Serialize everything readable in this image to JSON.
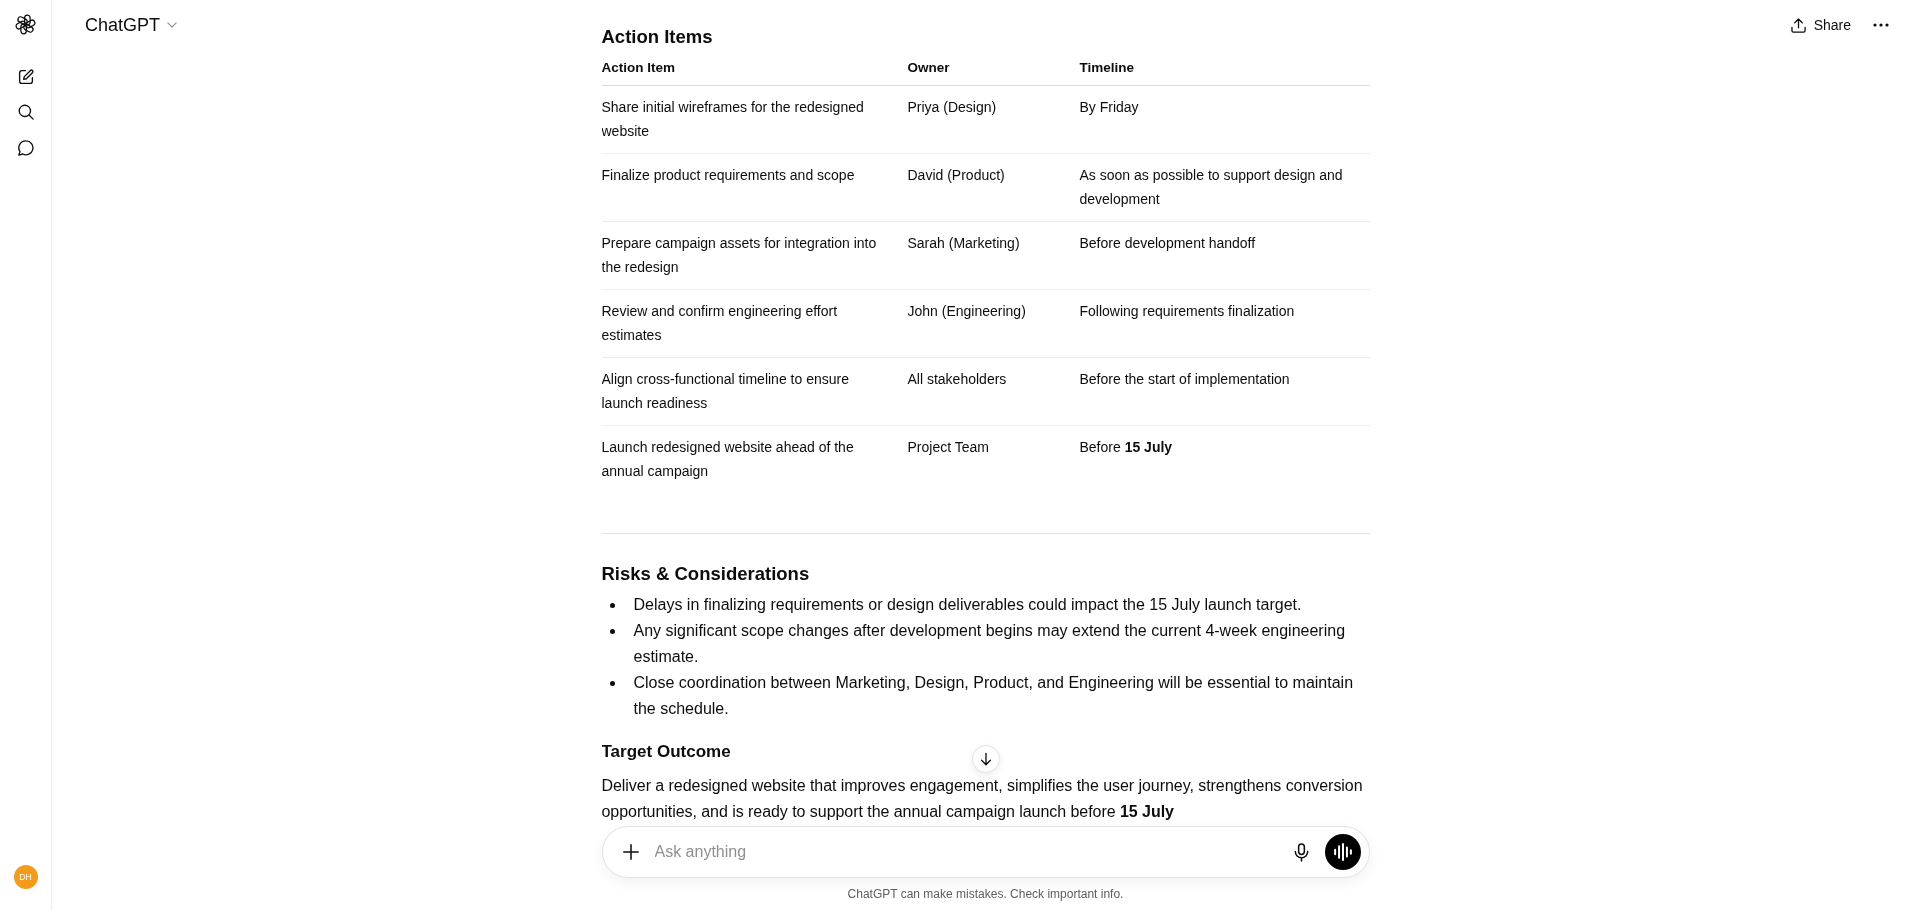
{
  "sidebar": {
    "avatar_initials": "DH"
  },
  "header": {
    "title": "ChatGPT",
    "share_label": "Share"
  },
  "action_items": {
    "heading": "Action Items",
    "columns": [
      "Action Item",
      "Owner",
      "Timeline"
    ],
    "rows": [
      [
        "Share initial wireframes for the redesigned website",
        "Priya (Design)",
        "By Friday"
      ],
      [
        "Finalize product requirements and scope",
        "David (Product)",
        "As soon as possible to support design and development"
      ],
      [
        "Prepare campaign assets for integration into the redesign",
        "Sarah (Marketing)",
        "Before development handoff"
      ],
      [
        "Review and confirm engineering effort estimates",
        "John (Engineering)",
        "Following requirements finalization"
      ],
      [
        "Align cross-functional timeline to ensure launch readiness",
        "All stakeholders",
        "Before the start of implementation"
      ],
      [
        "Launch redesigned website ahead of the annual campaign",
        "Project Team",
        "Before **15 July**"
      ]
    ]
  },
  "risks": {
    "heading": "Risks & Considerations",
    "items": [
      "Delays in finalizing requirements or design deliverables could impact the 15 July launch target.",
      "Any significant scope changes after development begins may extend the current 4-week engineering estimate.",
      "Close coordination between Marketing, Design, Product, and Engineering will be essential to maintain the schedule."
    ]
  },
  "target_outcome": {
    "heading": "Target Outcome",
    "text": "Deliver a redesigned website that improves engagement, simplifies the user journey, strengthens conversion opportunities, and is ready to support the annual campaign launch before **15 July**"
  },
  "composer": {
    "placeholder": "Ask anything"
  },
  "footer_note": "ChatGPT can make mistakes. Check important info."
}
